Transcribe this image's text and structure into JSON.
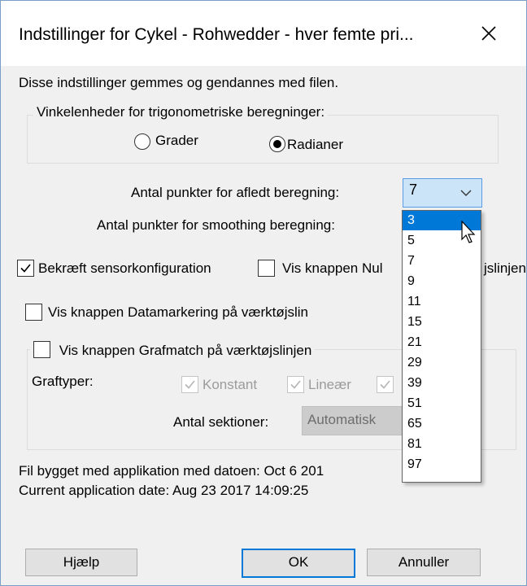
{
  "window": {
    "title": "Indstillinger for Cykel - Rohwedder - hver femte pri...",
    "close_icon": "close-icon"
  },
  "intro_text": "Disse indstillinger gemmes og gendannes med filen.",
  "angle_group": {
    "legend": "Vinkelenheder for trigonometriske beregninger:",
    "options": [
      {
        "label": "Grader",
        "checked": false
      },
      {
        "label": "Radianer",
        "checked": true
      }
    ]
  },
  "derivative_points": {
    "label": "Antal punkter for afledt beregning:",
    "value": "7"
  },
  "smoothing_points": {
    "label": "Antal punkter for smoothing beregning:"
  },
  "dropdown": {
    "options": [
      "3",
      "5",
      "7",
      "9",
      "11",
      "15",
      "21",
      "29",
      "39",
      "51",
      "65",
      "81",
      "97"
    ],
    "highlighted": "3"
  },
  "checkboxes": {
    "confirm_sensor": {
      "label": "Bekræft sensorkonfiguration",
      "checked": true
    },
    "show_zero_button": {
      "label": "Vis knappen Nul",
      "label_tail": "jslinjen",
      "checked": false
    },
    "show_data_marking": {
      "label": "Vis knappen Datamarkering på værktøjslin",
      "checked": false
    }
  },
  "graphmatch_group": {
    "legend": "Vis knappen Grafmatch på værktøjslinjen",
    "checked": false,
    "graph_types_label": "Graftyper:",
    "types": [
      {
        "label": "Konstant",
        "checked": true
      },
      {
        "label": "Lineær",
        "checked": true
      },
      {
        "label": "",
        "checked": true
      }
    ],
    "sections_label": "Antal sektioner:",
    "sections_value": "Automatisk"
  },
  "build_info": {
    "line1": "Fil bygget med applikation med datoen: Oct  6 201",
    "line2": "Current application date: Aug 23 2017 14:09:25"
  },
  "buttons": {
    "help": "Hjælp",
    "ok": "OK",
    "cancel": "Annuller"
  },
  "colors": {
    "accent": "#0078d7",
    "combo_bg": "#cce4f7"
  }
}
